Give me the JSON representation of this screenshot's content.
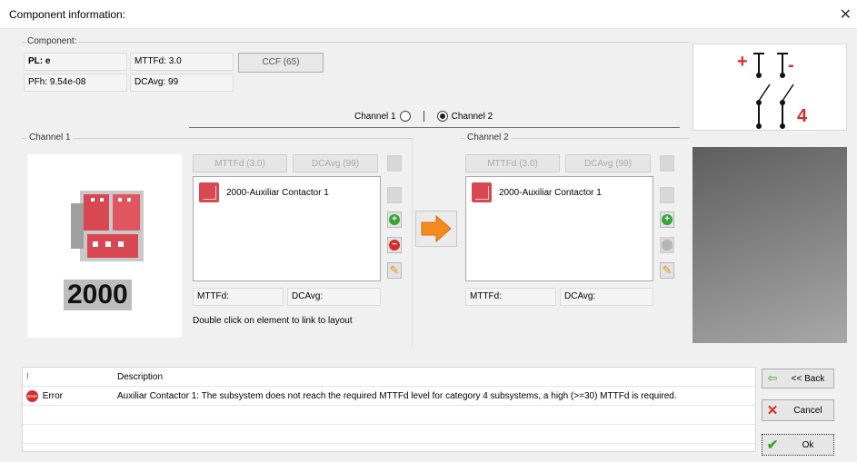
{
  "window": {
    "title": "Component information:",
    "close_icon": "close-icon"
  },
  "component": {
    "group_label": "Component:",
    "pl": "PL: e",
    "mttfd": "MTTFd: 3.0",
    "pfh": "PFh: 9.54e-08",
    "dcavg": "DCAvg: 99",
    "ccf_button": "CCF (65)"
  },
  "channel_selector": {
    "channel1_label": "Channel 1",
    "channel2_label": "Channel 2",
    "selected": "Channel 2"
  },
  "diagram": {
    "plus": "+",
    "minus": "-",
    "category": "4"
  },
  "channel1": {
    "group_label": "Channel 1",
    "product_label": "2000",
    "mttfd_button": "MTTFd (3.0)",
    "dcavg_button": "DCAvg (99)",
    "items": [
      {
        "label": "2000-Auxiliar Contactor 1"
      }
    ],
    "mttfd_field": "MTTFd:",
    "dcavg_field": "DCAvg:",
    "hint": "Double click on element to link to layout"
  },
  "channel2": {
    "group_label": "Channel 2",
    "mttfd_button": "MTTFd (3.0)",
    "dcavg_button": "DCAvg (99)",
    "items": [
      {
        "label": "2000-Auxiliar Contactor 1"
      }
    ],
    "mttfd_field": "MTTFd:",
    "dcavg_field": "DCAvg:"
  },
  "errors": {
    "col_icon": "!",
    "col_description": "Description",
    "rows": [
      {
        "type": "Error",
        "badge": "STOP",
        "description": "Auxiliar Contactor 1: The subsystem does not reach the required MTTFd level for category 4 subsystems, a high (>=30) MTTFd is required."
      }
    ]
  },
  "actions": {
    "back": "<< Back",
    "cancel": "Cancel",
    "ok": "Ok"
  },
  "colors": {
    "accent_red": "#d62c2c",
    "ok_green": "#3aa535",
    "arrow_orange": "#f28a1c"
  }
}
